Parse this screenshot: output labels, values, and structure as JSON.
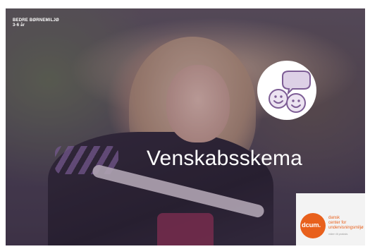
{
  "brand": {
    "line1": "BEDRE BØRNEMILJØ",
    "line2": "3-6 år"
  },
  "title": "Venskabsskema",
  "badge_icon": "friends-chat-icon",
  "logo": {
    "mark": "dcum.",
    "line1": "dansk",
    "line2": "center for",
    "line3": "undervisningsmiljø",
    "tagline": "viden til praksis"
  },
  "colors": {
    "overlay": "#462d55",
    "accent_purple": "#8a6aa8",
    "logo_orange": "#e8601c"
  }
}
